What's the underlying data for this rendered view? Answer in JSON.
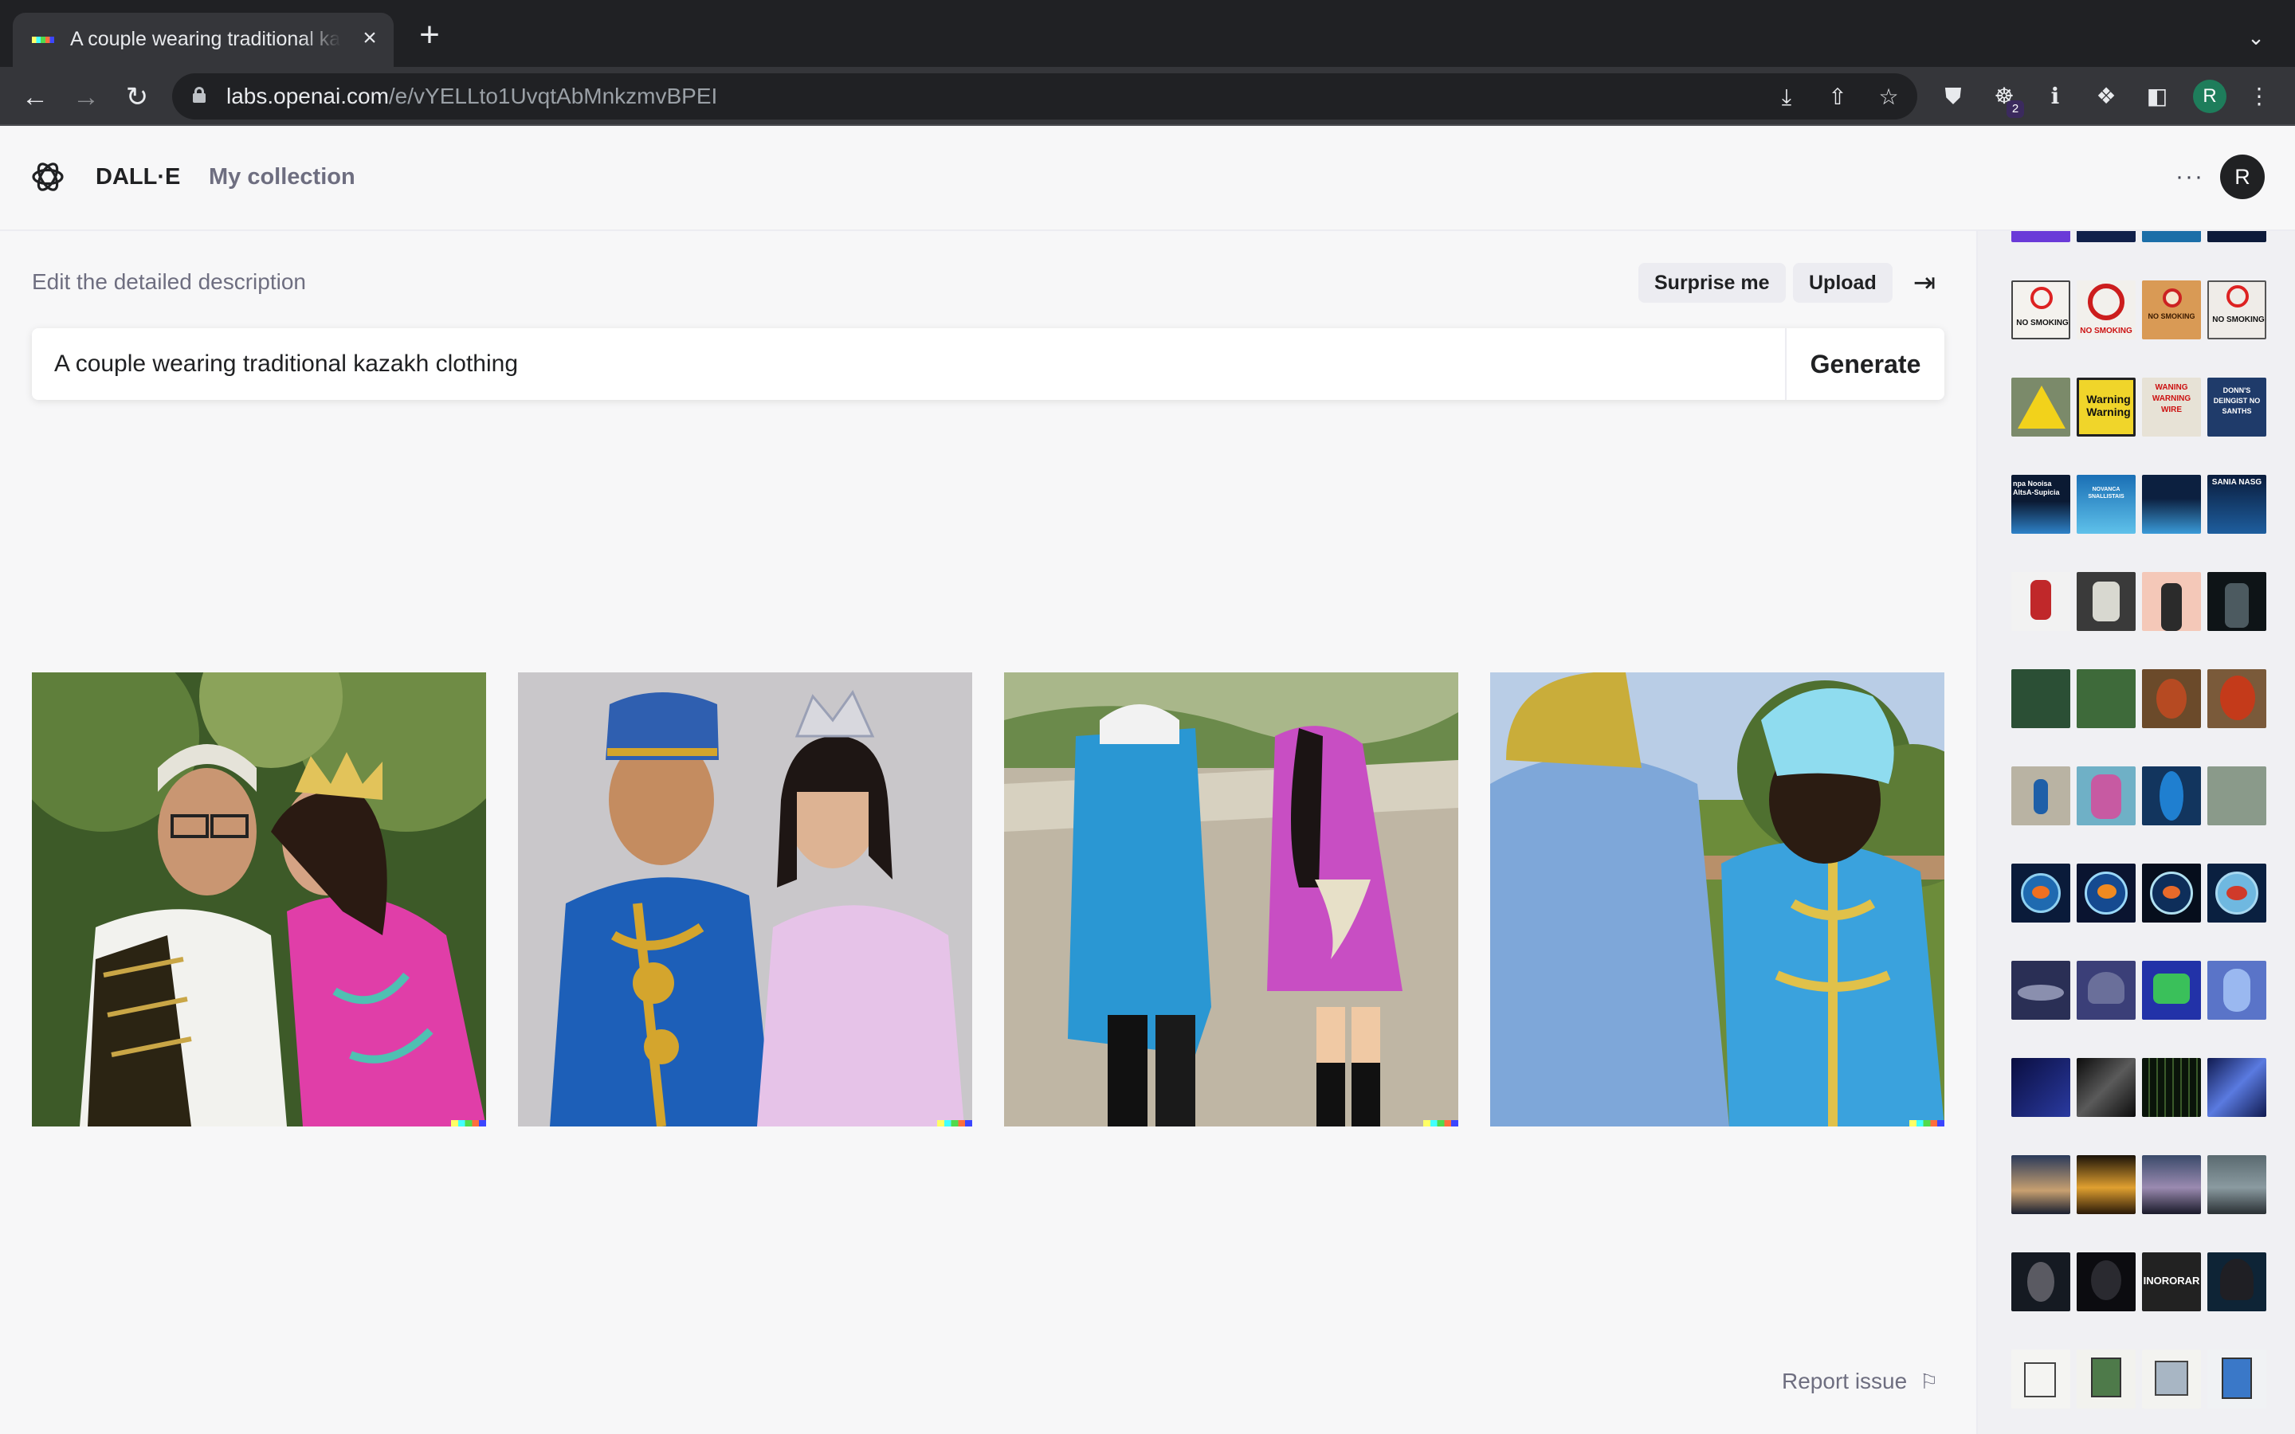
{
  "browser": {
    "tab_title": "A couple wearing traditional kazakh clothing",
    "tab_close_icon": "×",
    "new_tab_icon": "+",
    "tab_search_icon": "⌄",
    "url_host": "labs.openai.com",
    "url_path": "/e/vYELLto1UvqtAbMnkzmvBPEI",
    "profile_initial": "R",
    "extension_badge": "2"
  },
  "header": {
    "brand": "DALL·E",
    "collection_link": "My collection",
    "more_icon": "···",
    "avatar_initial": "R"
  },
  "editor": {
    "label": "Edit the detailed description",
    "surprise_button": "Surprise me",
    "upload_button": "Upload",
    "prompt_value": "A couple wearing traditional kazakh clothing",
    "generate_button": "Generate"
  },
  "footer": {
    "report_issue": "Report issue"
  },
  "history": {
    "sign_rows": [
      [
        "NO SMOKING",
        "NO SMOKING",
        "NO SMOKING",
        "NO SMOKING"
      ],
      [
        "",
        "Warning Warning",
        "WANING WARNING WIRE",
        "DONN'S DEINGIST NO SANTHS"
      ],
      [
        "npa Nooisa AltsA-Supicia",
        "NOVANCA SNALLISTAIS",
        "",
        "SANIA NASG"
      ]
    ],
    "caption_row": [
      "",
      "",
      "INORORAR",
      ""
    ]
  }
}
